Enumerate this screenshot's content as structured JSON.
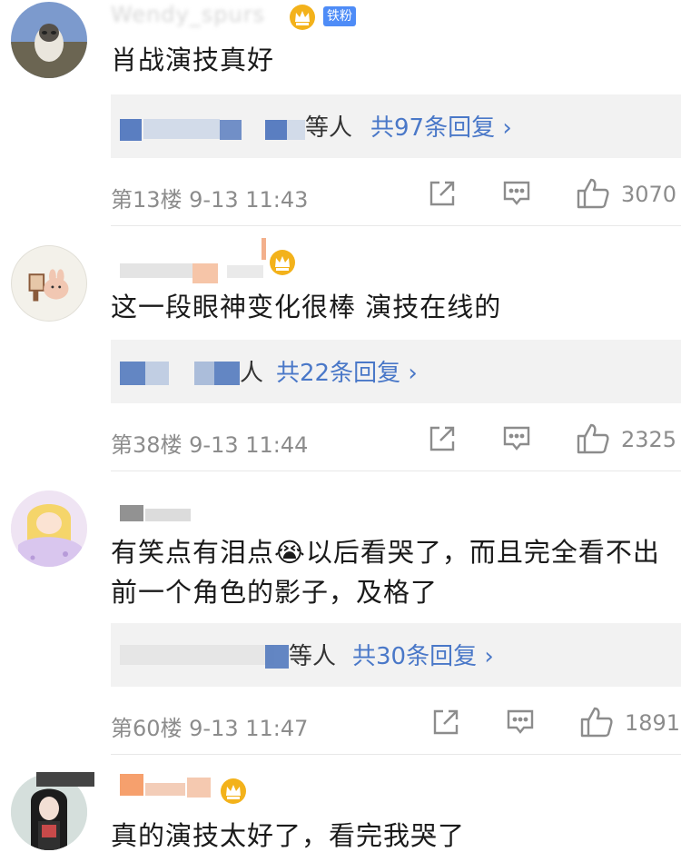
{
  "comments": [
    {
      "username": "Wendy_spurs",
      "badge": "铁粉",
      "text": "肖战演技真好",
      "reply_who": "等人",
      "reply_count": "共97条回复 ›",
      "floor_time": "第13楼 9-13 11:43",
      "likes": "3070"
    },
    {
      "username": "",
      "text": "这一段眼神变化很棒 演技在线的",
      "reply_who": "人",
      "reply_count": "共22条回复 ›",
      "floor_time": "第38楼 9-13 11:44",
      "likes": "2325"
    },
    {
      "username": "",
      "text": "有笑点有泪点😭以后看哭了，而且完全看不出前一个角色的影子，及格了",
      "reply_who": "等人",
      "reply_count": "共30条回复 ›",
      "floor_time": "第60楼 9-13 11:47",
      "likes": "1891"
    },
    {
      "username": "",
      "text": "真的演技太好了，看完我哭了"
    }
  ],
  "icons": {
    "share": "share-icon",
    "comment": "comment-icon",
    "like": "thumbs-up-icon",
    "crown": "crown-icon"
  },
  "colors": {
    "link": "#4a78c8",
    "badge": "#4e8cf7",
    "meta": "#8c8c8c",
    "reply_bg": "#f2f2f2"
  }
}
